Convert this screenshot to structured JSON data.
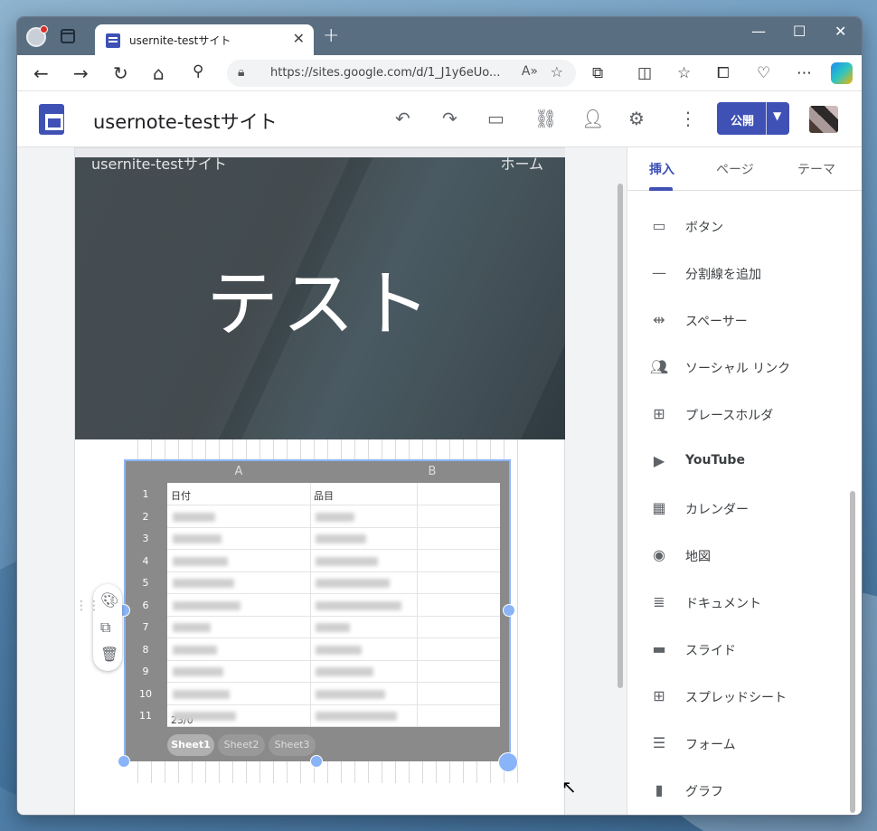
{
  "browser": {
    "tab_title": "usernite-testサイト",
    "url": "https://sites.google.com/d/1_J1y6eUo..."
  },
  "sites": {
    "site_title": "usernote-testサイト",
    "publish_label": "公開"
  },
  "page": {
    "hero_site_name": "usernite-testサイト",
    "hero_nav": "ホーム",
    "hero_title": "テスト"
  },
  "sheet": {
    "columns": [
      "A",
      "B"
    ],
    "rows": [
      "1",
      "2",
      "3",
      "4",
      "5",
      "6",
      "7",
      "8",
      "9",
      "10",
      "11"
    ],
    "header_a": "日付",
    "header_b": "品目",
    "row11_a": "23/0",
    "tabs": [
      "Sheet1",
      "Sheet2",
      "Sheet3"
    ]
  },
  "panel": {
    "tabs": [
      "挿入",
      "ページ",
      "テーマ"
    ],
    "items": [
      {
        "label": "ボタン",
        "icon": "button-icon"
      },
      {
        "label": "分割線を追加",
        "icon": "divider-icon"
      },
      {
        "label": "スペーサー",
        "icon": "spacer-icon"
      },
      {
        "label": "ソーシャル リンク",
        "icon": "social-links-icon"
      },
      {
        "label": "プレースホルダ",
        "icon": "placeholder-icon"
      },
      {
        "label": "YouTube",
        "icon": "youtube-icon"
      },
      {
        "label": "カレンダー",
        "icon": "calendar-icon"
      },
      {
        "label": "地図",
        "icon": "map-icon"
      },
      {
        "label": "ドキュメント",
        "icon": "docs-icon"
      },
      {
        "label": "スライド",
        "icon": "slides-icon"
      },
      {
        "label": "スプレッドシート",
        "icon": "sheets-icon"
      },
      {
        "label": "フォーム",
        "icon": "forms-icon"
      },
      {
        "label": "グラフ",
        "icon": "chart-icon"
      }
    ]
  },
  "colors": {
    "brand": "#3f51b5",
    "selection": "#8ab4f8"
  }
}
